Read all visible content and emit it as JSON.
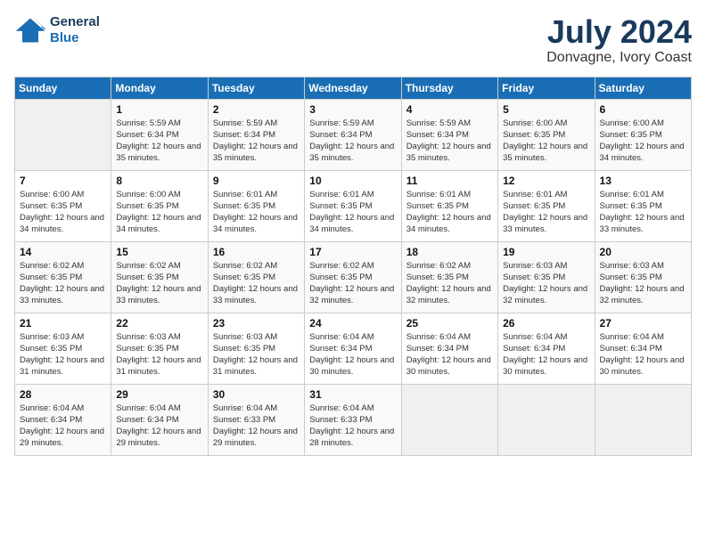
{
  "header": {
    "logo_line1": "General",
    "logo_line2": "Blue",
    "month": "July 2024",
    "location": "Donvagne, Ivory Coast"
  },
  "weekdays": [
    "Sunday",
    "Monday",
    "Tuesday",
    "Wednesday",
    "Thursday",
    "Friday",
    "Saturday"
  ],
  "weeks": [
    [
      {
        "day": "",
        "sunrise": "",
        "sunset": "",
        "daylight": ""
      },
      {
        "day": "1",
        "sunrise": "Sunrise: 5:59 AM",
        "sunset": "Sunset: 6:34 PM",
        "daylight": "Daylight: 12 hours and 35 minutes."
      },
      {
        "day": "2",
        "sunrise": "Sunrise: 5:59 AM",
        "sunset": "Sunset: 6:34 PM",
        "daylight": "Daylight: 12 hours and 35 minutes."
      },
      {
        "day": "3",
        "sunrise": "Sunrise: 5:59 AM",
        "sunset": "Sunset: 6:34 PM",
        "daylight": "Daylight: 12 hours and 35 minutes."
      },
      {
        "day": "4",
        "sunrise": "Sunrise: 5:59 AM",
        "sunset": "Sunset: 6:34 PM",
        "daylight": "Daylight: 12 hours and 35 minutes."
      },
      {
        "day": "5",
        "sunrise": "Sunrise: 6:00 AM",
        "sunset": "Sunset: 6:35 PM",
        "daylight": "Daylight: 12 hours and 35 minutes."
      },
      {
        "day": "6",
        "sunrise": "Sunrise: 6:00 AM",
        "sunset": "Sunset: 6:35 PM",
        "daylight": "Daylight: 12 hours and 34 minutes."
      }
    ],
    [
      {
        "day": "7",
        "sunrise": "Sunrise: 6:00 AM",
        "sunset": "Sunset: 6:35 PM",
        "daylight": "Daylight: 12 hours and 34 minutes."
      },
      {
        "day": "8",
        "sunrise": "Sunrise: 6:00 AM",
        "sunset": "Sunset: 6:35 PM",
        "daylight": "Daylight: 12 hours and 34 minutes."
      },
      {
        "day": "9",
        "sunrise": "Sunrise: 6:01 AM",
        "sunset": "Sunset: 6:35 PM",
        "daylight": "Daylight: 12 hours and 34 minutes."
      },
      {
        "day": "10",
        "sunrise": "Sunrise: 6:01 AM",
        "sunset": "Sunset: 6:35 PM",
        "daylight": "Daylight: 12 hours and 34 minutes."
      },
      {
        "day": "11",
        "sunrise": "Sunrise: 6:01 AM",
        "sunset": "Sunset: 6:35 PM",
        "daylight": "Daylight: 12 hours and 34 minutes."
      },
      {
        "day": "12",
        "sunrise": "Sunrise: 6:01 AM",
        "sunset": "Sunset: 6:35 PM",
        "daylight": "Daylight: 12 hours and 33 minutes."
      },
      {
        "day": "13",
        "sunrise": "Sunrise: 6:01 AM",
        "sunset": "Sunset: 6:35 PM",
        "daylight": "Daylight: 12 hours and 33 minutes."
      }
    ],
    [
      {
        "day": "14",
        "sunrise": "Sunrise: 6:02 AM",
        "sunset": "Sunset: 6:35 PM",
        "daylight": "Daylight: 12 hours and 33 minutes."
      },
      {
        "day": "15",
        "sunrise": "Sunrise: 6:02 AM",
        "sunset": "Sunset: 6:35 PM",
        "daylight": "Daylight: 12 hours and 33 minutes."
      },
      {
        "day": "16",
        "sunrise": "Sunrise: 6:02 AM",
        "sunset": "Sunset: 6:35 PM",
        "daylight": "Daylight: 12 hours and 33 minutes."
      },
      {
        "day": "17",
        "sunrise": "Sunrise: 6:02 AM",
        "sunset": "Sunset: 6:35 PM",
        "daylight": "Daylight: 12 hours and 32 minutes."
      },
      {
        "day": "18",
        "sunrise": "Sunrise: 6:02 AM",
        "sunset": "Sunset: 6:35 PM",
        "daylight": "Daylight: 12 hours and 32 minutes."
      },
      {
        "day": "19",
        "sunrise": "Sunrise: 6:03 AM",
        "sunset": "Sunset: 6:35 PM",
        "daylight": "Daylight: 12 hours and 32 minutes."
      },
      {
        "day": "20",
        "sunrise": "Sunrise: 6:03 AM",
        "sunset": "Sunset: 6:35 PM",
        "daylight": "Daylight: 12 hours and 32 minutes."
      }
    ],
    [
      {
        "day": "21",
        "sunrise": "Sunrise: 6:03 AM",
        "sunset": "Sunset: 6:35 PM",
        "daylight": "Daylight: 12 hours and 31 minutes."
      },
      {
        "day": "22",
        "sunrise": "Sunrise: 6:03 AM",
        "sunset": "Sunset: 6:35 PM",
        "daylight": "Daylight: 12 hours and 31 minutes."
      },
      {
        "day": "23",
        "sunrise": "Sunrise: 6:03 AM",
        "sunset": "Sunset: 6:35 PM",
        "daylight": "Daylight: 12 hours and 31 minutes."
      },
      {
        "day": "24",
        "sunrise": "Sunrise: 6:04 AM",
        "sunset": "Sunset: 6:34 PM",
        "daylight": "Daylight: 12 hours and 30 minutes."
      },
      {
        "day": "25",
        "sunrise": "Sunrise: 6:04 AM",
        "sunset": "Sunset: 6:34 PM",
        "daylight": "Daylight: 12 hours and 30 minutes."
      },
      {
        "day": "26",
        "sunrise": "Sunrise: 6:04 AM",
        "sunset": "Sunset: 6:34 PM",
        "daylight": "Daylight: 12 hours and 30 minutes."
      },
      {
        "day": "27",
        "sunrise": "Sunrise: 6:04 AM",
        "sunset": "Sunset: 6:34 PM",
        "daylight": "Daylight: 12 hours and 30 minutes."
      }
    ],
    [
      {
        "day": "28",
        "sunrise": "Sunrise: 6:04 AM",
        "sunset": "Sunset: 6:34 PM",
        "daylight": "Daylight: 12 hours and 29 minutes."
      },
      {
        "day": "29",
        "sunrise": "Sunrise: 6:04 AM",
        "sunset": "Sunset: 6:34 PM",
        "daylight": "Daylight: 12 hours and 29 minutes."
      },
      {
        "day": "30",
        "sunrise": "Sunrise: 6:04 AM",
        "sunset": "Sunset: 6:33 PM",
        "daylight": "Daylight: 12 hours and 29 minutes."
      },
      {
        "day": "31",
        "sunrise": "Sunrise: 6:04 AM",
        "sunset": "Sunset: 6:33 PM",
        "daylight": "Daylight: 12 hours and 28 minutes."
      },
      {
        "day": "",
        "sunrise": "",
        "sunset": "",
        "daylight": ""
      },
      {
        "day": "",
        "sunrise": "",
        "sunset": "",
        "daylight": ""
      },
      {
        "day": "",
        "sunrise": "",
        "sunset": "",
        "daylight": ""
      }
    ]
  ]
}
